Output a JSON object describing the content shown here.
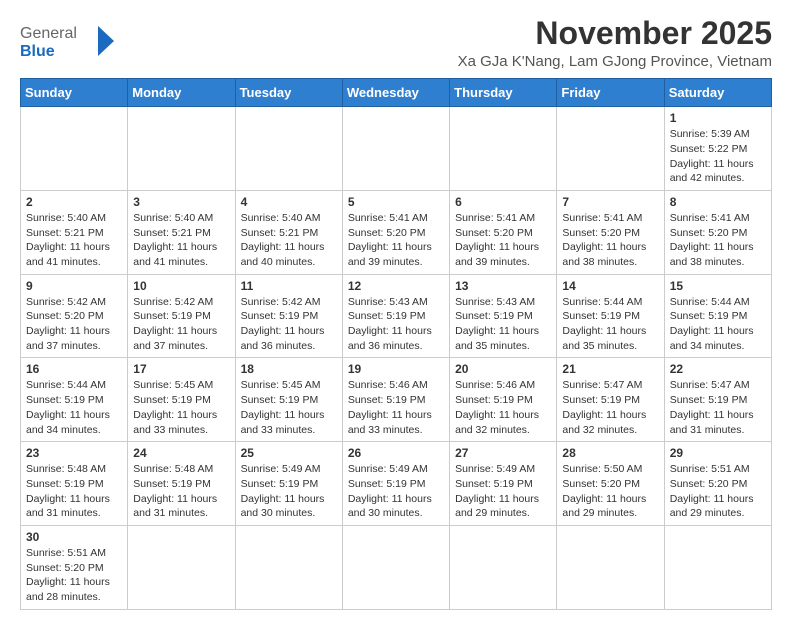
{
  "header": {
    "logo_general": "General",
    "logo_blue": "Blue",
    "month_title": "November 2025",
    "location": "Xa GJa K'Nang, Lam GJong Province, Vietnam"
  },
  "days_of_week": [
    "Sunday",
    "Monday",
    "Tuesday",
    "Wednesday",
    "Thursday",
    "Friday",
    "Saturday"
  ],
  "weeks": [
    [
      {
        "day": null,
        "info": null
      },
      {
        "day": null,
        "info": null
      },
      {
        "day": null,
        "info": null
      },
      {
        "day": null,
        "info": null
      },
      {
        "day": null,
        "info": null
      },
      {
        "day": null,
        "info": null
      },
      {
        "day": "1",
        "info": "Sunrise: 5:39 AM\nSunset: 5:22 PM\nDaylight: 11 hours\nand 42 minutes."
      }
    ],
    [
      {
        "day": "2",
        "info": "Sunrise: 5:40 AM\nSunset: 5:21 PM\nDaylight: 11 hours\nand 41 minutes."
      },
      {
        "day": "3",
        "info": "Sunrise: 5:40 AM\nSunset: 5:21 PM\nDaylight: 11 hours\nand 41 minutes."
      },
      {
        "day": "4",
        "info": "Sunrise: 5:40 AM\nSunset: 5:21 PM\nDaylight: 11 hours\nand 40 minutes."
      },
      {
        "day": "5",
        "info": "Sunrise: 5:41 AM\nSunset: 5:20 PM\nDaylight: 11 hours\nand 39 minutes."
      },
      {
        "day": "6",
        "info": "Sunrise: 5:41 AM\nSunset: 5:20 PM\nDaylight: 11 hours\nand 39 minutes."
      },
      {
        "day": "7",
        "info": "Sunrise: 5:41 AM\nSunset: 5:20 PM\nDaylight: 11 hours\nand 38 minutes."
      },
      {
        "day": "8",
        "info": "Sunrise: 5:41 AM\nSunset: 5:20 PM\nDaylight: 11 hours\nand 38 minutes."
      }
    ],
    [
      {
        "day": "9",
        "info": "Sunrise: 5:42 AM\nSunset: 5:20 PM\nDaylight: 11 hours\nand 37 minutes."
      },
      {
        "day": "10",
        "info": "Sunrise: 5:42 AM\nSunset: 5:19 PM\nDaylight: 11 hours\nand 37 minutes."
      },
      {
        "day": "11",
        "info": "Sunrise: 5:42 AM\nSunset: 5:19 PM\nDaylight: 11 hours\nand 36 minutes."
      },
      {
        "day": "12",
        "info": "Sunrise: 5:43 AM\nSunset: 5:19 PM\nDaylight: 11 hours\nand 36 minutes."
      },
      {
        "day": "13",
        "info": "Sunrise: 5:43 AM\nSunset: 5:19 PM\nDaylight: 11 hours\nand 35 minutes."
      },
      {
        "day": "14",
        "info": "Sunrise: 5:44 AM\nSunset: 5:19 PM\nDaylight: 11 hours\nand 35 minutes."
      },
      {
        "day": "15",
        "info": "Sunrise: 5:44 AM\nSunset: 5:19 PM\nDaylight: 11 hours\nand 34 minutes."
      }
    ],
    [
      {
        "day": "16",
        "info": "Sunrise: 5:44 AM\nSunset: 5:19 PM\nDaylight: 11 hours\nand 34 minutes."
      },
      {
        "day": "17",
        "info": "Sunrise: 5:45 AM\nSunset: 5:19 PM\nDaylight: 11 hours\nand 33 minutes."
      },
      {
        "day": "18",
        "info": "Sunrise: 5:45 AM\nSunset: 5:19 PM\nDaylight: 11 hours\nand 33 minutes."
      },
      {
        "day": "19",
        "info": "Sunrise: 5:46 AM\nSunset: 5:19 PM\nDaylight: 11 hours\nand 33 minutes."
      },
      {
        "day": "20",
        "info": "Sunrise: 5:46 AM\nSunset: 5:19 PM\nDaylight: 11 hours\nand 32 minutes."
      },
      {
        "day": "21",
        "info": "Sunrise: 5:47 AM\nSunset: 5:19 PM\nDaylight: 11 hours\nand 32 minutes."
      },
      {
        "day": "22",
        "info": "Sunrise: 5:47 AM\nSunset: 5:19 PM\nDaylight: 11 hours\nand 31 minutes."
      }
    ],
    [
      {
        "day": "23",
        "info": "Sunrise: 5:48 AM\nSunset: 5:19 PM\nDaylight: 11 hours\nand 31 minutes."
      },
      {
        "day": "24",
        "info": "Sunrise: 5:48 AM\nSunset: 5:19 PM\nDaylight: 11 hours\nand 31 minutes."
      },
      {
        "day": "25",
        "info": "Sunrise: 5:49 AM\nSunset: 5:19 PM\nDaylight: 11 hours\nand 30 minutes."
      },
      {
        "day": "26",
        "info": "Sunrise: 5:49 AM\nSunset: 5:19 PM\nDaylight: 11 hours\nand 30 minutes."
      },
      {
        "day": "27",
        "info": "Sunrise: 5:49 AM\nSunset: 5:19 PM\nDaylight: 11 hours\nand 29 minutes."
      },
      {
        "day": "28",
        "info": "Sunrise: 5:50 AM\nSunset: 5:20 PM\nDaylight: 11 hours\nand 29 minutes."
      },
      {
        "day": "29",
        "info": "Sunrise: 5:51 AM\nSunset: 5:20 PM\nDaylight: 11 hours\nand 29 minutes."
      }
    ],
    [
      {
        "day": "30",
        "info": "Sunrise: 5:51 AM\nSunset: 5:20 PM\nDaylight: 11 hours\nand 28 minutes."
      },
      {
        "day": null,
        "info": null
      },
      {
        "day": null,
        "info": null
      },
      {
        "day": null,
        "info": null
      },
      {
        "day": null,
        "info": null
      },
      {
        "day": null,
        "info": null
      },
      {
        "day": null,
        "info": null
      }
    ]
  ]
}
